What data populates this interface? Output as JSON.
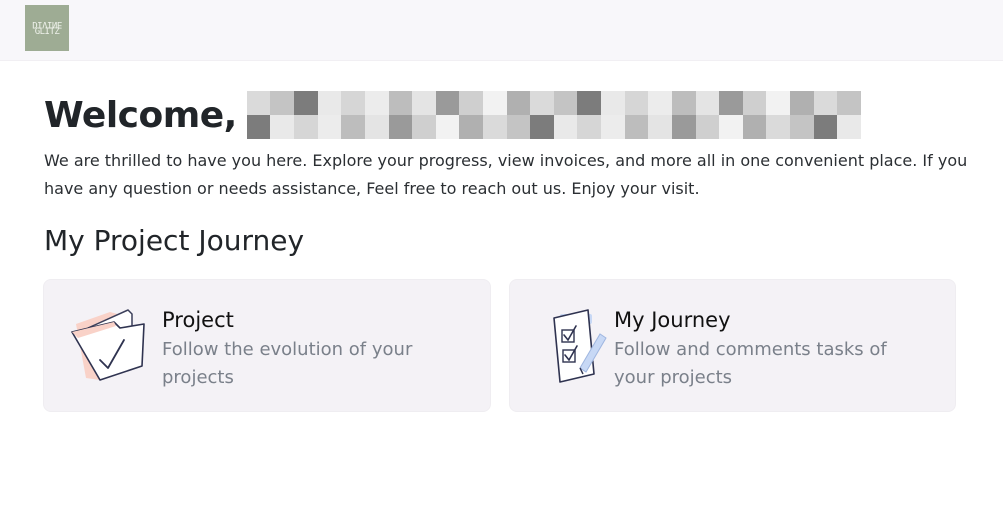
{
  "header": {
    "logo_line1": "DIVINE",
    "logo_line2": "GLITZ"
  },
  "welcome": {
    "greeting": "Welcome,",
    "intro": "We are thrilled to have you here. Explore your progress, view invoices, and more all in one convenient place. If you have any question or needs assistance, Feel free to reach out us. Enjoy your visit."
  },
  "section": {
    "title": "My Project Journey"
  },
  "cards": [
    {
      "title": "Project",
      "description": "Follow the evolution of your projects",
      "icon": "folder-check-icon"
    },
    {
      "title": "My Journey",
      "description": "Follow and comments tasks of your projects",
      "icon": "checklist-clipboard-icon"
    }
  ],
  "colors": {
    "topbar": "#f8f7fa",
    "logo": "#9eac94",
    "card_bg": "#f4f2f6",
    "card_desc": "#7a808a",
    "folder_accent": "#f9d2c8",
    "clipboard_accent": "#c7d8f5"
  }
}
